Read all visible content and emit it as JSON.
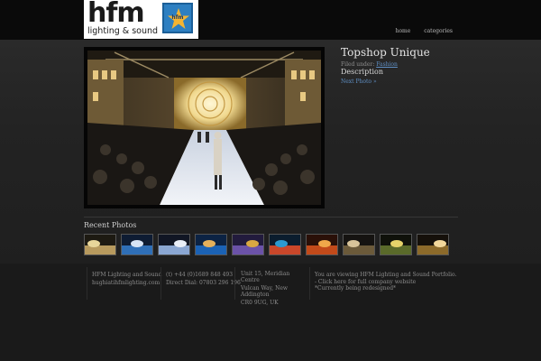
{
  "header": {
    "logo_main": "hfm",
    "logo_sub": "lighting & sound",
    "logo_badge": "hfm",
    "nav": [
      "home",
      "categories"
    ]
  },
  "post": {
    "title": "Topshop Unique",
    "filed_label": "Filed under:",
    "category": "Fashion",
    "description_heading": "Description",
    "next_link": "Next Photo »"
  },
  "recent": {
    "heading": "Recent Photos",
    "thumbs": [
      {
        "name": "thumb-1",
        "palette": [
          "#1d1a12",
          "#b79a5e",
          "#e8d69a"
        ]
      },
      {
        "name": "thumb-2",
        "palette": [
          "#0e1c33",
          "#2f6fb7",
          "#d7e4f5"
        ]
      },
      {
        "name": "thumb-3",
        "palette": [
          "#111624",
          "#8aa6d2",
          "#e9eef8"
        ]
      },
      {
        "name": "thumb-4",
        "palette": [
          "#0c2344",
          "#1b62b5",
          "#e5b05b"
        ]
      },
      {
        "name": "thumb-5",
        "palette": [
          "#221b3d",
          "#6b52a8",
          "#d9a841"
        ]
      },
      {
        "name": "thumb-6",
        "palette": [
          "#0b1d2e",
          "#c9472a",
          "#2b9ad0"
        ]
      },
      {
        "name": "thumb-7",
        "palette": [
          "#2a1008",
          "#c24a1a",
          "#f0a84a"
        ]
      },
      {
        "name": "thumb-8",
        "palette": [
          "#151311",
          "#6b5a3a",
          "#d8c49a"
        ]
      },
      {
        "name": "thumb-9",
        "palette": [
          "#0f110a",
          "#5a6a2a",
          "#e6d36a"
        ]
      },
      {
        "name": "thumb-10",
        "palette": [
          "#15100a",
          "#8c6a2a",
          "#f2d79a"
        ]
      }
    ]
  },
  "footer": {
    "col1": [
      "HFM Lighting and Sound",
      "hughiatihfmlighting.com"
    ],
    "col2": [
      "(t) +44 (0)1689 848 493",
      "Direct Dial: 07803 296 196"
    ],
    "col3": [
      "Unit 15, Meridian Centre",
      "Vulcan Way, New",
      "Addington",
      "CR0 9UG, UK"
    ],
    "col4": [
      "You are viewing HFM Lighting and Sound Portfolio.",
      "- Click here for full company website",
      "*Currently being redesigned*"
    ]
  },
  "colors": {
    "link": "#5f8fc4",
    "badge_blue": "#2d7fc1",
    "badge_star": "#f4b431"
  },
  "icons": {
    "logo_badge": "star-badge-icon"
  }
}
